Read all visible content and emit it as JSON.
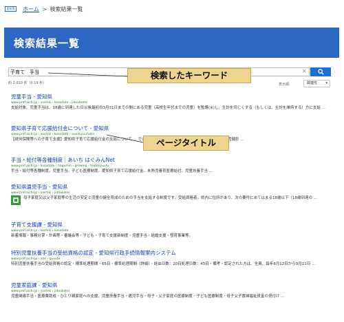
{
  "header": {
    "logo_text": "愛知県",
    "breadcrumb": {
      "home": "ホーム",
      "separator": ">",
      "current": "検索結果一覧"
    }
  },
  "title_bar": {
    "title": "検索結果一覧"
  },
  "search": {
    "query": "子育て　手当",
    "clear_icon": "close-icon",
    "button_icon": "search-icon"
  },
  "stats": "約 2,010 件（0.19 秒）",
  "sort": {
    "label": "表示順:",
    "selected": "関連性"
  },
  "results": [
    {
      "title": "児童手当 - 愛知県",
      "url": "www.pref.aichi.jp › soshiki › kosodate › jidouteate",
      "snippet": "支給対象、児童手当は、18歳に到達した日以後最初の3月31日までの間にある児童（高校生年代までの児童）を監護(※)し、生計を同じくする（もしくは、主計を維持する）方に支給 ..."
    },
    {
      "title": "愛知県子育て応援給付金について - 愛知県",
      "url": "www.pref.aichi.jp › soshiki › kosodate › ouenkyuufukin",
      "snippet": "【続何保険等への子育て支援】愛知県子育て応援給付金の支給について ... であります。を ... ではありません。（別）：1歳6か月児健診 ..."
    },
    {
      "title": "手当・給付等各種制度｜あいち はぐみんNet",
      "url": "www.pref.aichi.jp › kosodate › hagumin › growing › teatekyuufu",
      "snippet": "手当・給付等各種制度。児童手当。子ども医療制度。愛知県子育て応援給付金。未熟児養育医療給付。児童扶養手当 ..."
    },
    {
      "title": "愛知県遺児手当 - 愛知県",
      "url": "www.pref.aichi.jp › soshiki › jidoukatei",
      "snippet": "母子家庭又は父子家庭等の生活の安定と児童の健全育成のための手当を支給する制度です。受給資格者。県内に住所があり、次の要件にあてはまる18歳以下（18歳到達の ..."
    },
    {
      "title": "子育て支援課 - 愛知県",
      "url": "www.pref.aichi.jp › soshiki › kosodate",
      "snippet": "新着情報・事務分掌・計画等・審議会等・子ども・子育て支援新制度・児童手当・結婚支援・發育事業等。"
    },
    {
      "title": "特別児童扶養手当の受給資格の認定 - 愛知県行政手続情報案内システム",
      "url": "www.pref.aichi.jp › site › gyoute",
      "snippet": "特別児童扶養手当の受給資格の認定・標準処理期間・65日・標準処理期間（詳細）・経由日数：20日処理日数：45日・備考・認定された方は、全員、毎年8月12日から9月11日 ..."
    },
    {
      "title": "児童家庭課 - 愛知県",
      "url": "www.pref.aichi.jp › soshiki › jidoukatei",
      "snippet": "児童関連手当・医療費助成・ひとり親家庭への支援、児童扶養手当・遺児手当・母子・父子家庭の医療制度・子ども医療制度・母子父子寡婦福祉資金の貸付け ..."
    }
  ],
  "callouts": {
    "keyword": "検索したキーワード",
    "page_title": "ページタイトル"
  },
  "colors": {
    "title_bar": "#2e66c3",
    "link": "#1a3fb8",
    "url": "#2f7a2f",
    "callout": "#ecd48f"
  }
}
